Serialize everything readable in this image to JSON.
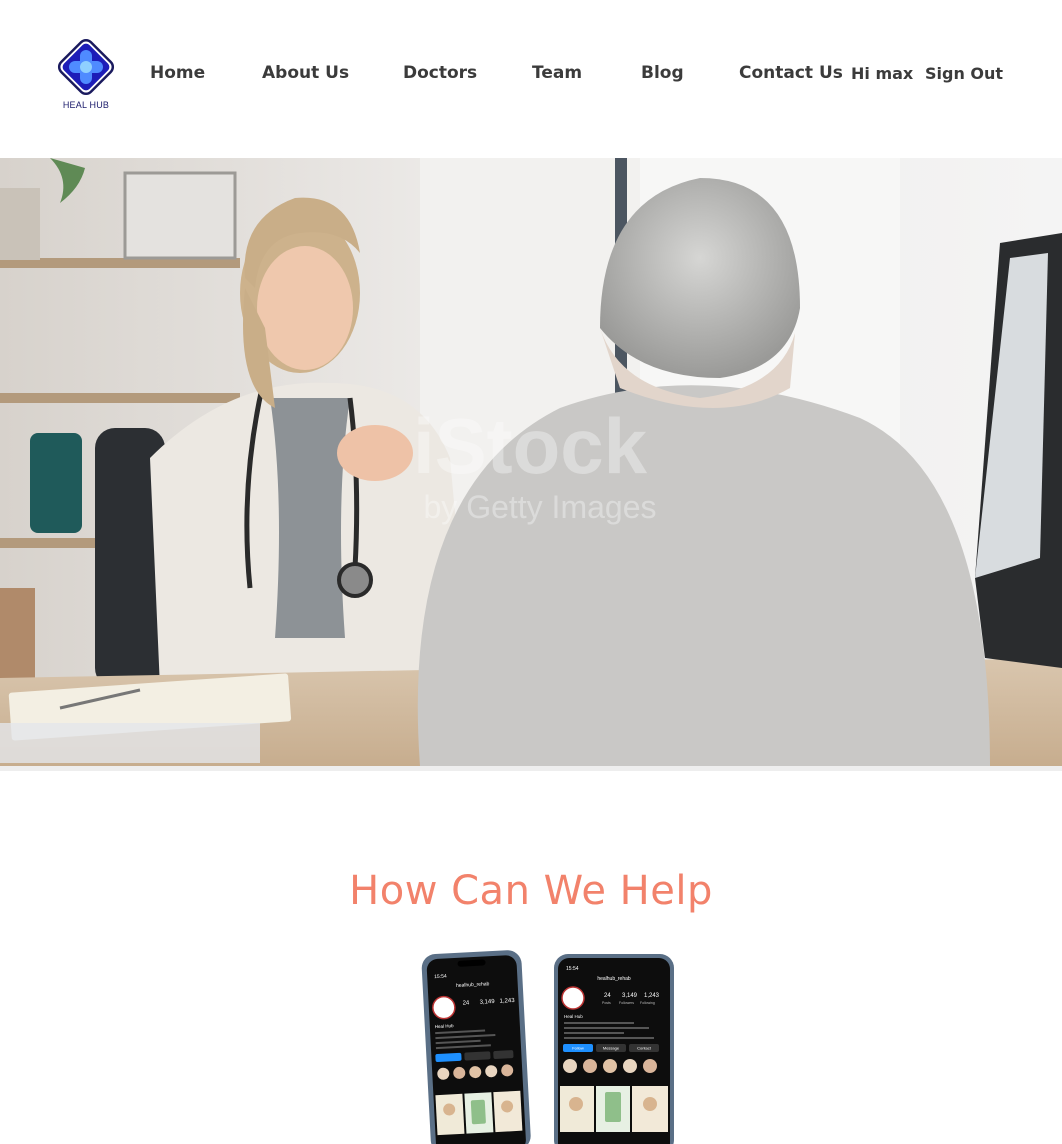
{
  "brand": {
    "name": "HEAL HUB",
    "accent": "#1d1db8",
    "accent_light": "#3aa0ff"
  },
  "nav": {
    "items": [
      "Home",
      "About Us",
      "Doctors",
      "Team",
      "Blog",
      "Contact Us"
    ],
    "greeting": "Hi max",
    "signout": "Sign Out"
  },
  "hero": {
    "watermark_main": "iStock",
    "watermark_sub": "by Getty Images",
    "alt": "doctor-consultation-photo"
  },
  "help": {
    "title": "How Can We Help",
    "title_color": "#f2826b",
    "phones": [
      {
        "status_time": "15:54",
        "account": "healhub_rehab",
        "profile_name": "Heal Hub",
        "posts": "24",
        "followers": "3,149",
        "following": "1,243",
        "posts_label": "Posts",
        "followers_label": "Followers",
        "following_label": "Following",
        "follow_button": "Follow",
        "message_button": "Message",
        "contact_button": "Contact"
      },
      {
        "status_time": "15:54",
        "account": "healhub_rehab",
        "profile_name": "Heal Hub",
        "posts": "24",
        "followers": "3,149",
        "following": "1,243",
        "posts_label": "Posts",
        "followers_label": "Followers",
        "following_label": "Following",
        "follow_button": "Follow",
        "message_button": "Message",
        "contact_button": "Contact"
      }
    ]
  }
}
